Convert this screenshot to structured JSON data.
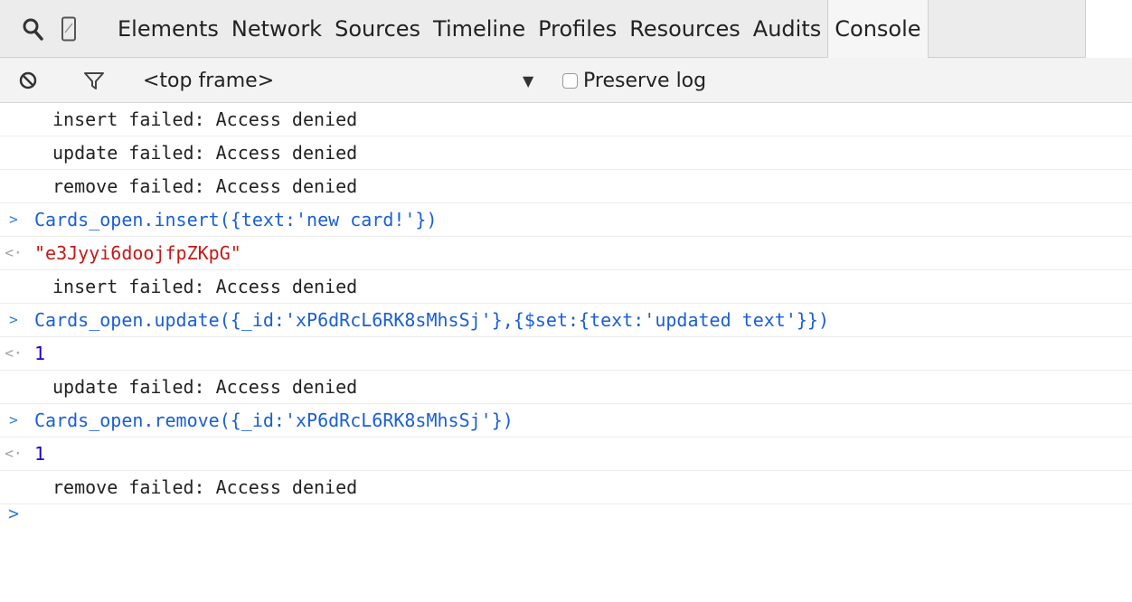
{
  "tabs": [
    "Elements",
    "Network",
    "Sources",
    "Timeline",
    "Profiles",
    "Resources",
    "Audits",
    "Console"
  ],
  "toolbar": {
    "frame_label": "<top frame>",
    "preserve_label": "Preserve log"
  },
  "console": {
    "rows": [
      {
        "kind": "msg",
        "text": "insert failed: Access denied"
      },
      {
        "kind": "msg",
        "text": "update failed: Access denied"
      },
      {
        "kind": "msg",
        "text": "remove failed: Access denied"
      },
      {
        "kind": "code",
        "prefix": ">",
        "text": "Cards_open.insert({text:'new card!'})"
      },
      {
        "kind": "str",
        "prefix": "<·",
        "text": "\"e3Jyyi6doojfpZKpG\""
      },
      {
        "kind": "msg",
        "text": "insert failed: Access denied"
      },
      {
        "kind": "code",
        "prefix": ">",
        "text": "Cards_open.update({_id:'xP6dRcL6RK8sMhsSj'},{$set:{text:'updated text'}})"
      },
      {
        "kind": "num",
        "prefix": "<·",
        "text": "1"
      },
      {
        "kind": "msg",
        "text": "update failed: Access denied"
      },
      {
        "kind": "code",
        "prefix": ">",
        "text": "Cards_open.remove({_id:'xP6dRcL6RK8sMhsSj'})"
      },
      {
        "kind": "num",
        "prefix": "<·",
        "text": "1"
      },
      {
        "kind": "msg",
        "text": "remove failed: Access denied"
      }
    ],
    "prompt_symbol": ">"
  },
  "colors": {
    "code": "#1a5fd6",
    "string": "#c41a16",
    "number": "#1c00cf",
    "message": "#222222"
  }
}
